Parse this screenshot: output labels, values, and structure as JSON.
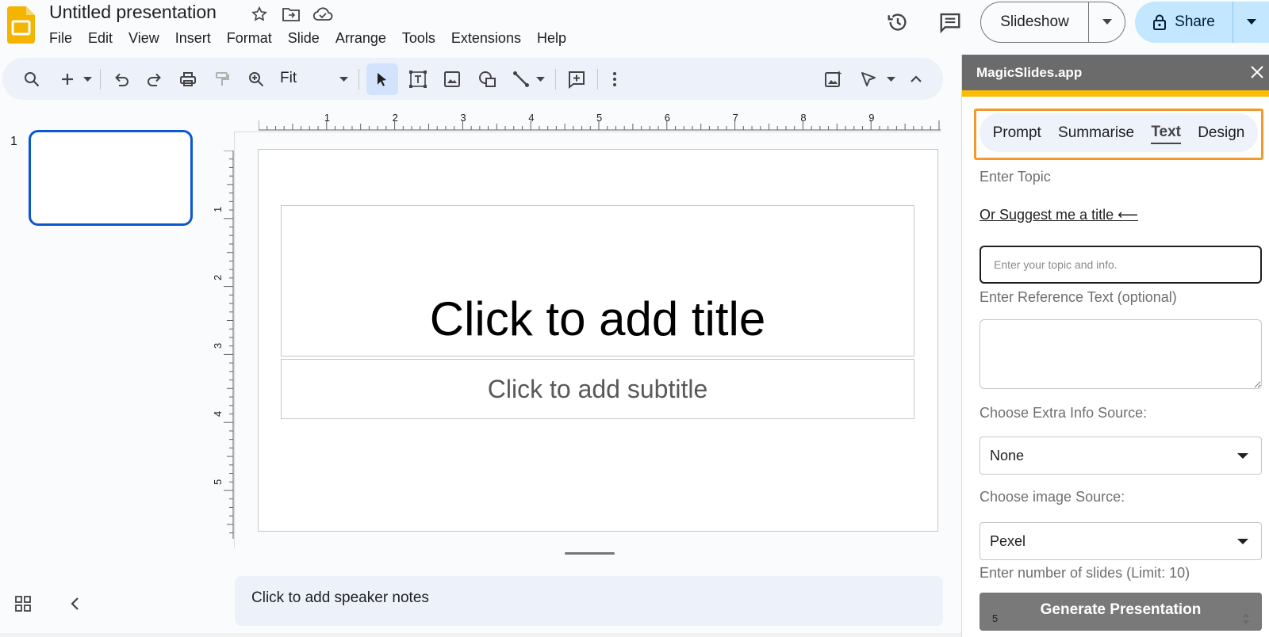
{
  "app": {
    "doc_title": "Untitled presentation",
    "title_icons": [
      "star-icon",
      "move-to-folder-icon",
      "cloud-saved-icon"
    ],
    "menu": [
      "File",
      "Edit",
      "View",
      "Insert",
      "Format",
      "Slide",
      "Arrange",
      "Tools",
      "Extensions",
      "Help"
    ],
    "header_buttons": {
      "slideshow_label": "Slideshow",
      "share_label": "Share"
    }
  },
  "toolbar": {
    "zoom_value": "Fit",
    "icons": [
      "search-icon",
      "new-slide-icon",
      "undo-icon",
      "redo-icon",
      "print-icon",
      "paint-format-icon",
      "zoom-icon",
      "select-icon",
      "text-box-icon",
      "image-icon",
      "shape-icon",
      "line-icon",
      "comment-icon",
      "more-icon",
      "image-background-icon",
      "pointer-mode-icon",
      "collapse-toolbar-icon"
    ]
  },
  "filmstrip": {
    "slides": [
      {
        "number": "1"
      }
    ]
  },
  "rulers": {
    "horizontal": [
      "1",
      "2",
      "3",
      "4",
      "5",
      "6",
      "7",
      "8",
      "9"
    ],
    "vertical": [
      "1",
      "2",
      "3",
      "4",
      "5"
    ]
  },
  "slide": {
    "title_placeholder": "Click to add title",
    "subtitle_placeholder": "Click to add subtitle"
  },
  "notes": {
    "placeholder": "Click to add speaker notes"
  },
  "panel": {
    "title": "MagicSlides.app",
    "tabs": [
      {
        "label": "Prompt",
        "active": false
      },
      {
        "label": "Summarise",
        "active": false
      },
      {
        "label": "Text",
        "active": true
      },
      {
        "label": "Design",
        "active": false
      }
    ],
    "topic_label": "Enter Topic",
    "suggest_link": "Or Suggest me a title ⟵",
    "topic_placeholder": "Enter your topic and info.",
    "reference_label": "Enter Reference Text (optional)",
    "extra_source_label": "Choose Extra Info Source:",
    "extra_source_value": "None",
    "image_source_label": "Choose image Source:",
    "image_source_value": "Pexel",
    "slides_count_label": "Enter number of slides (Limit: 10)",
    "slides_count_value": "5",
    "generate_label": "Generate Presentation"
  },
  "colors": {
    "accent_blue": "#0b57d0",
    "share_bg": "#c2e7ff",
    "panel_header": "#6b6b6b",
    "panel_accent": "#fbbc04",
    "tab_highlight": "#f2992e",
    "slides_logo": "#f4b400"
  }
}
